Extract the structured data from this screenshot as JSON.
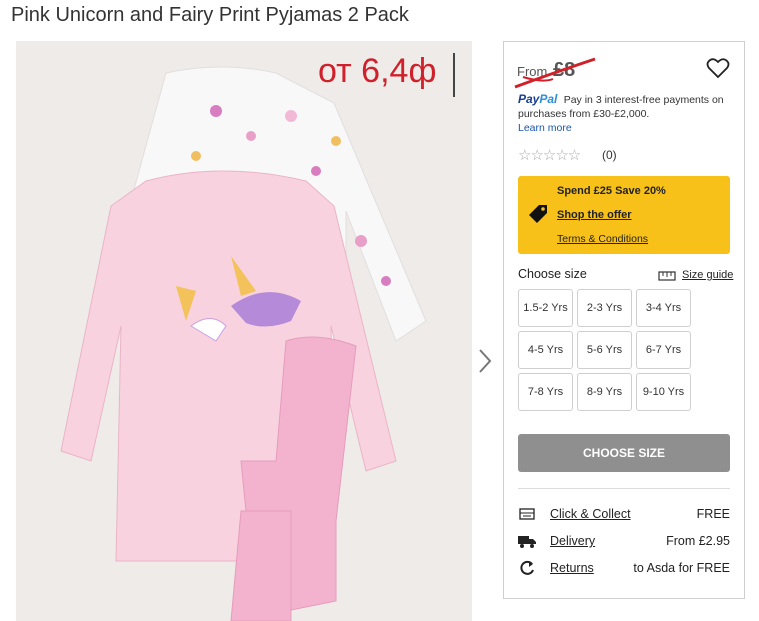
{
  "page": {
    "title": "Pink Unicorn and Fairy Print Pyjamas 2 Pack"
  },
  "overlay": {
    "price_text": "от 6,4ф"
  },
  "panel": {
    "from_label": "From",
    "price": "£8",
    "paypal": {
      "logo_pay": "Pay",
      "logo_pal": "Pal",
      "text": "Pay in 3 interest-free payments on purchases from £30-£2,000.",
      "learn_more": "Learn more"
    },
    "rating": {
      "stars": "☆☆☆☆☆",
      "count": "(0)"
    },
    "offer": {
      "headline": "Spend £25 Save 20%",
      "shop": "Shop the offer",
      "terms": "Terms & Conditions",
      "bg_color": "#f7c11a"
    },
    "size": {
      "label": "Choose size",
      "guide": "Size guide",
      "options": [
        "1.5-2 Yrs",
        "2-3 Yrs",
        "3-4 Yrs",
        "4-5 Yrs",
        "5-6 Yrs",
        "6-7 Yrs",
        "7-8 Yrs",
        "8-9 Yrs",
        "9-10 Yrs"
      ]
    },
    "choose_button": "CHOOSE SIZE",
    "delivery": [
      {
        "icon": "store-icon",
        "label": "Click & Collect",
        "value": "FREE"
      },
      {
        "icon": "truck-icon",
        "label": "Delivery",
        "value": "From £2.95"
      },
      {
        "icon": "return-icon",
        "label": "Returns",
        "value": "to Asda for FREE"
      }
    ]
  }
}
